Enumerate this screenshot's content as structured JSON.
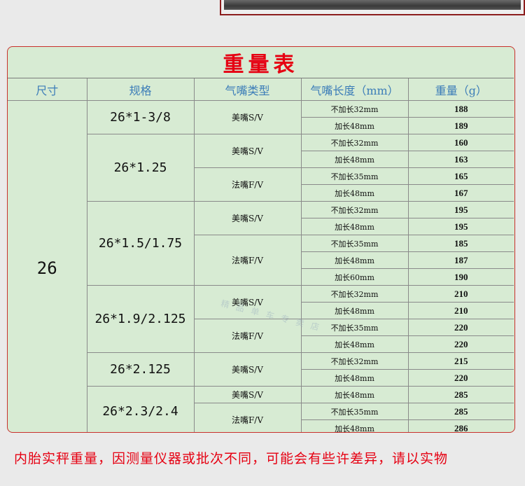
{
  "title": "重量表",
  "headers": [
    "尺寸",
    "规格",
    "气嘴类型",
    "气嘴长度（mm）",
    "重量（g）"
  ],
  "size": "26",
  "rows": [
    {
      "spec": "26*1-3/8",
      "spec_span": 2,
      "valve": "美嘴S/V",
      "valve_span": 2,
      "length": "不加长32mm",
      "weight": "188"
    },
    {
      "length": "加长48mm",
      "weight": "189"
    },
    {
      "spec": "26*1.25",
      "spec_span": 4,
      "valve": "美嘴S/V",
      "valve_span": 2,
      "length": "不加长32mm",
      "weight": "160"
    },
    {
      "length": "加长48mm",
      "weight": "163"
    },
    {
      "valve": "法嘴F/V",
      "valve_span": 2,
      "length": "不加长35mm",
      "weight": "165"
    },
    {
      "length": "加长48mm",
      "weight": "167"
    },
    {
      "spec": "26*1.5/1.75",
      "spec_span": 5,
      "valve": "美嘴S/V",
      "valve_span": 2,
      "length": "不加长32mm",
      "weight": "195"
    },
    {
      "length": "加长48mm",
      "weight": "195"
    },
    {
      "valve": "法嘴F/V",
      "valve_span": 3,
      "length": "不加长35mm",
      "weight": "185"
    },
    {
      "length": "加长48mm",
      "weight": "187"
    },
    {
      "length": "加长60mm",
      "weight": "190"
    },
    {
      "spec": "26*1.9/2.125",
      "spec_span": 4,
      "valve": "美嘴S/V",
      "valve_span": 2,
      "length": "不加长32mm",
      "weight": "210"
    },
    {
      "length": "加长48mm",
      "weight": "210"
    },
    {
      "valve": "法嘴F/V",
      "valve_span": 2,
      "length": "不加长35mm",
      "weight": "220"
    },
    {
      "length": "加长48mm",
      "weight": "220"
    },
    {
      "spec": "26*2.125",
      "spec_span": 2,
      "valve": "美嘴S/V",
      "valve_span": 2,
      "length": "不加长32mm",
      "weight": "215"
    },
    {
      "length": "加长48mm",
      "weight": "220"
    },
    {
      "spec": "26*2.3/2.4",
      "spec_span": 3,
      "valve": "美嘴S/V",
      "valve_span": 1,
      "length": "加长48mm",
      "weight": "285"
    },
    {
      "valve": "法嘴F/V",
      "valve_span": 2,
      "length": "不加长35mm",
      "weight": "285"
    },
    {
      "length": "加长48mm",
      "weight": "286"
    }
  ],
  "footer": "内胎实秤重量，因测量仪器或批次不同，可能会有些许差异，请以实物",
  "colors": {
    "title": "#e60012",
    "header_text": "#3c7db8",
    "table_bg": "#d7ebd3",
    "border": "#c8302c"
  }
}
